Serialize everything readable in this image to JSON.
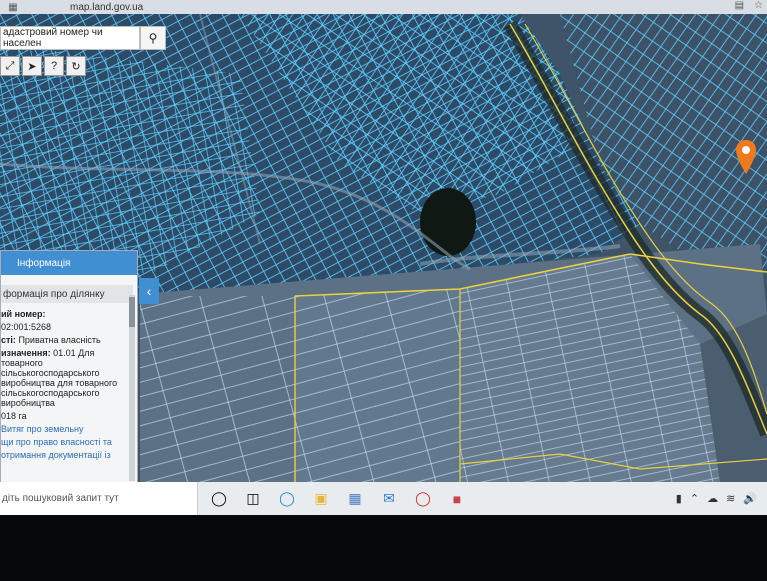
{
  "browser": {
    "url": "map.land.gov.ua",
    "tab_icon": "grid-icon"
  },
  "search": {
    "placeholder": "адастровий номер чи населен",
    "button_icon": "search-icon"
  },
  "toolbar": {
    "tools": [
      "expand-icon",
      "pointer-icon",
      "help-icon",
      "route-icon"
    ]
  },
  "info_panel": {
    "title": "Інформація",
    "section": "формація про ділянку",
    "rows": [
      {
        "label": "ий номер:",
        "value": ""
      },
      {
        "label": "",
        "value": "02:001:5268"
      },
      {
        "label": "сті:",
        "value": "Приватна власність"
      },
      {
        "label": "изначення:",
        "value": "01.01 Для товарного сільськогосподарського виробництва для товарного сільськогосподарського виробництва"
      },
      {
        "label": "",
        "value": "018 га"
      }
    ],
    "links": [
      "Витяг про земельну",
      "щи про право власності та",
      "отримання документації із"
    ]
  },
  "taskbar": {
    "search_placeholder": "діть пошуковий запит тут",
    "icons": [
      "task-view-icon",
      "edge-icon",
      "file-explorer-icon",
      "store-icon",
      "mail-icon",
      "opera-icon",
      "app-icon"
    ],
    "tray": [
      "battery-icon",
      "chevron-up-icon",
      "cloud-icon",
      "wifi-icon",
      "volume-icon"
    ]
  },
  "colors": {
    "parcel_line": "#5fd0ff",
    "boundary": "#e8d040",
    "panel_header": "#3f8fd2",
    "marker": "#f07a1a"
  }
}
